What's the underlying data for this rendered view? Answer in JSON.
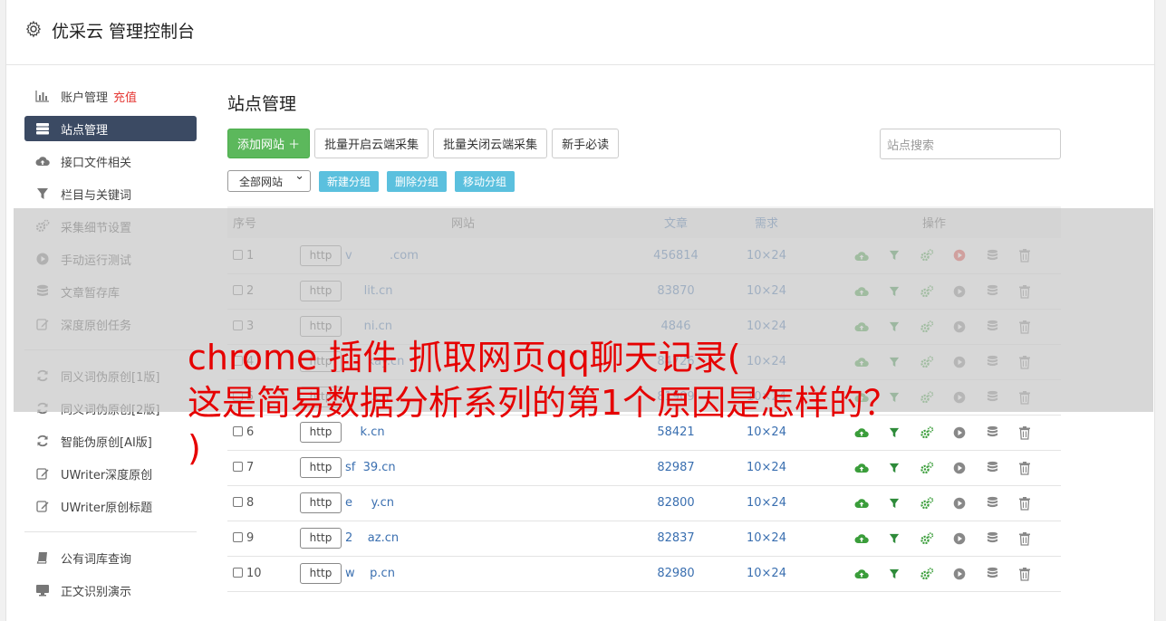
{
  "app_title": "优采云 管理控制台",
  "sidebar": {
    "group1": [
      {
        "icon": "bar-chart-icon",
        "label": "账户管理",
        "extra": "充值"
      },
      {
        "icon": "server-icon",
        "label": "站点管理",
        "active": true
      },
      {
        "icon": "cloud-upload-icon",
        "label": "接口文件相关"
      },
      {
        "icon": "filter-icon",
        "label": "栏目与关键词"
      },
      {
        "icon": "gears-icon",
        "label": "采集细节设置"
      },
      {
        "icon": "play-circle-icon",
        "label": "手动运行测试"
      },
      {
        "icon": "database-icon",
        "label": "文章暂存库"
      },
      {
        "icon": "edit-icon",
        "label": "深度原创任务"
      }
    ],
    "group2": [
      {
        "icon": "refresh-icon",
        "label": "同义词伪原创[1版]"
      },
      {
        "icon": "refresh-icon",
        "label": "同义词伪原创[2版]"
      },
      {
        "icon": "refresh-icon",
        "label": "智能伪原创[AI版]"
      },
      {
        "icon": "edit-icon",
        "label": "UWriter深度原创"
      },
      {
        "icon": "edit-icon",
        "label": "UWriter原创标题"
      }
    ],
    "group3": [
      {
        "icon": "book-icon",
        "label": "公有词库查询"
      },
      {
        "icon": "monitor-icon",
        "label": "正文识别演示"
      }
    ]
  },
  "main": {
    "title": "站点管理",
    "toolbar": {
      "add_site": "添加网站 ＋",
      "batch_open": "批量开启云端采集",
      "batch_close": "批量关闭云端采集",
      "newbie": "新手必读"
    },
    "search": {
      "placeholder": "站点搜索"
    },
    "group_select": "全部网站",
    "group_buttons": {
      "new": "新建分组",
      "delete": "删除分组",
      "move": "移动分组"
    },
    "table": {
      "headers": {
        "no": "序号",
        "site": "网站",
        "articles": "文章",
        "demand": "需求",
        "ops": "操作"
      },
      "rows": [
        {
          "no": "1",
          "proto": "http",
          "domain": "v          .com",
          "articles": "456814",
          "demand": "10×24"
        },
        {
          "no": "2",
          "proto": "http",
          "domain": "     lit.cn",
          "articles": "83870",
          "demand": "10×24"
        },
        {
          "no": "3",
          "proto": "http",
          "domain": "     ni.cn",
          "articles": "4846",
          "demand": "10×24"
        },
        {
          "no": "4",
          "proto": "http",
          "domain": "      kay.cn",
          "articles": "84726",
          "demand": "10×24"
        },
        {
          "no": "5",
          "proto": "http",
          "domain": "       .cn",
          "articles": "81909",
          "demand": "10×24"
        },
        {
          "no": "6",
          "proto": "http",
          "domain": "    k.cn",
          "articles": "58421",
          "demand": "10×24"
        },
        {
          "no": "7",
          "proto": "http",
          "domain": "sf  39.cn",
          "articles": "82987",
          "demand": "10×24"
        },
        {
          "no": "8",
          "proto": "http",
          "domain": "e     y.cn",
          "articles": "82800",
          "demand": "10×24"
        },
        {
          "no": "9",
          "proto": "http",
          "domain": "2    az.cn",
          "articles": "82837",
          "demand": "10×24"
        },
        {
          "no": "10",
          "proto": "http",
          "domain": "w    p.cn",
          "articles": "82980",
          "demand": "10×24"
        }
      ]
    }
  },
  "overlay_text": {
    "line1": "chrome 插件 抓取网页qq聊天记录(",
    "line2": "这是简易数据分析系列的第1个原因是怎样的？",
    "line3": ")"
  },
  "colors": {
    "green": "#5cb85c",
    "info": "#5bc0de",
    "sidebar_active": "#3b4a63",
    "overlay_text": "#e60000",
    "link": "#3a6fb0"
  }
}
